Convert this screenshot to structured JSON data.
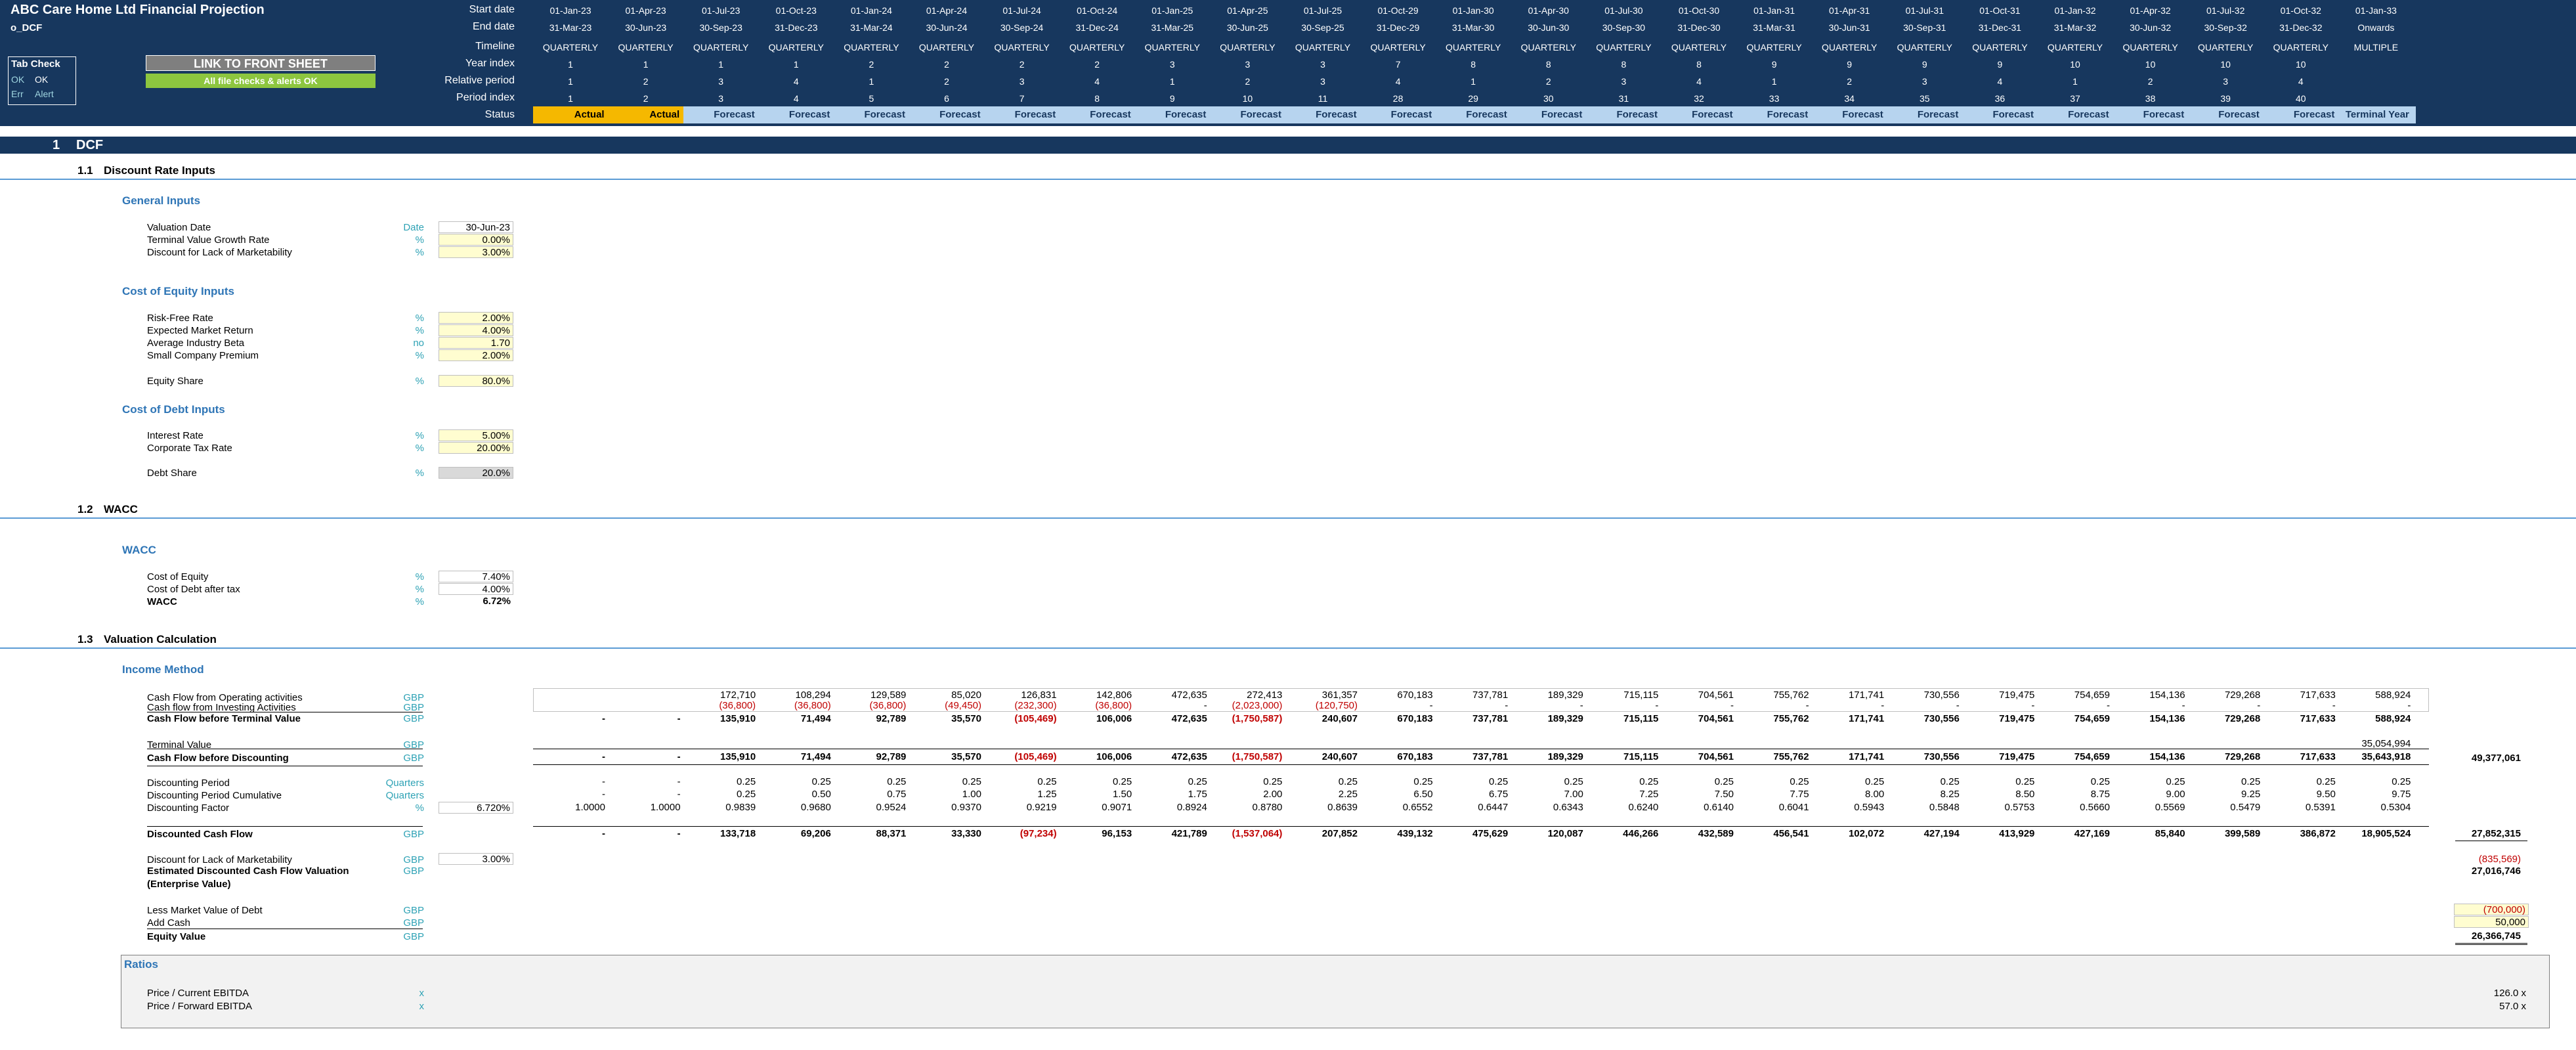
{
  "header": {
    "title": "ABC Care Home Ltd Financial Projection",
    "sheet": "o_DCF"
  },
  "tab_check": {
    "title": "Tab Check",
    "ok_a": "OK",
    "ok_b": "OK",
    "err": "Err",
    "alert": "Alert"
  },
  "buttons": {
    "front_sheet": "LINK TO FRONT SHEET",
    "checks": "All file checks & alerts OK"
  },
  "timeline_labels": [
    "Start date",
    "End date",
    "Timeline",
    "Year index",
    "Relative period",
    "Period index",
    "Status"
  ],
  "periods": [
    {
      "start": "01-Jan-23",
      "end": "31-Mar-23",
      "timeline": "QUARTERLY",
      "year": "1",
      "rel": "1",
      "idx": "1",
      "status": "Actual"
    },
    {
      "start": "01-Apr-23",
      "end": "30-Jun-23",
      "timeline": "QUARTERLY",
      "year": "1",
      "rel": "2",
      "idx": "2",
      "status": "Actual"
    },
    {
      "start": "01-Jul-23",
      "end": "30-Sep-23",
      "timeline": "QUARTERLY",
      "year": "1",
      "rel": "3",
      "idx": "3",
      "status": "Forecast"
    },
    {
      "start": "01-Oct-23",
      "end": "31-Dec-23",
      "timeline": "QUARTERLY",
      "year": "1",
      "rel": "4",
      "idx": "4",
      "status": "Forecast"
    },
    {
      "start": "01-Jan-24",
      "end": "31-Mar-24",
      "timeline": "QUARTERLY",
      "year": "2",
      "rel": "1",
      "idx": "5",
      "status": "Forecast"
    },
    {
      "start": "01-Apr-24",
      "end": "30-Jun-24",
      "timeline": "QUARTERLY",
      "year": "2",
      "rel": "2",
      "idx": "6",
      "status": "Forecast"
    },
    {
      "start": "01-Jul-24",
      "end": "30-Sep-24",
      "timeline": "QUARTERLY",
      "year": "2",
      "rel": "3",
      "idx": "7",
      "status": "Forecast"
    },
    {
      "start": "01-Oct-24",
      "end": "31-Dec-24",
      "timeline": "QUARTERLY",
      "year": "2",
      "rel": "4",
      "idx": "8",
      "status": "Forecast"
    },
    {
      "start": "01-Jan-25",
      "end": "31-Mar-25",
      "timeline": "QUARTERLY",
      "year": "3",
      "rel": "1",
      "idx": "9",
      "status": "Forecast"
    },
    {
      "start": "01-Apr-25",
      "end": "30-Jun-25",
      "timeline": "QUARTERLY",
      "year": "3",
      "rel": "2",
      "idx": "10",
      "status": "Forecast"
    },
    {
      "start": "01-Jul-25",
      "end": "30-Sep-25",
      "timeline": "QUARTERLY",
      "year": "3",
      "rel": "3",
      "idx": "11",
      "status": "Forecast"
    },
    {
      "start": "01-Oct-29",
      "end": "31-Dec-29",
      "timeline": "QUARTERLY",
      "year": "7",
      "rel": "4",
      "idx": "28",
      "status": "Forecast"
    },
    {
      "start": "01-Jan-30",
      "end": "31-Mar-30",
      "timeline": "QUARTERLY",
      "year": "8",
      "rel": "1",
      "idx": "29",
      "status": "Forecast"
    },
    {
      "start": "01-Apr-30",
      "end": "30-Jun-30",
      "timeline": "QUARTERLY",
      "year": "8",
      "rel": "2",
      "idx": "30",
      "status": "Forecast"
    },
    {
      "start": "01-Jul-30",
      "end": "30-Sep-30",
      "timeline": "QUARTERLY",
      "year": "8",
      "rel": "3",
      "idx": "31",
      "status": "Forecast"
    },
    {
      "start": "01-Oct-30",
      "end": "31-Dec-30",
      "timeline": "QUARTERLY",
      "year": "8",
      "rel": "4",
      "idx": "32",
      "status": "Forecast"
    },
    {
      "start": "01-Jan-31",
      "end": "31-Mar-31",
      "timeline": "QUARTERLY",
      "year": "9",
      "rel": "1",
      "idx": "33",
      "status": "Forecast"
    },
    {
      "start": "01-Apr-31",
      "end": "30-Jun-31",
      "timeline": "QUARTERLY",
      "year": "9",
      "rel": "2",
      "idx": "34",
      "status": "Forecast"
    },
    {
      "start": "01-Jul-31",
      "end": "30-Sep-31",
      "timeline": "QUARTERLY",
      "year": "9",
      "rel": "3",
      "idx": "35",
      "status": "Forecast"
    },
    {
      "start": "01-Oct-31",
      "end": "31-Dec-31",
      "timeline": "QUARTERLY",
      "year": "9",
      "rel": "4",
      "idx": "36",
      "status": "Forecast"
    },
    {
      "start": "01-Jan-32",
      "end": "31-Mar-32",
      "timeline": "QUARTERLY",
      "year": "10",
      "rel": "1",
      "idx": "37",
      "status": "Forecast"
    },
    {
      "start": "01-Apr-32",
      "end": "30-Jun-32",
      "timeline": "QUARTERLY",
      "year": "10",
      "rel": "2",
      "idx": "38",
      "status": "Forecast"
    },
    {
      "start": "01-Jul-32",
      "end": "30-Sep-32",
      "timeline": "QUARTERLY",
      "year": "10",
      "rel": "3",
      "idx": "39",
      "status": "Forecast"
    },
    {
      "start": "01-Oct-32",
      "end": "31-Dec-32",
      "timeline": "QUARTERLY",
      "year": "10",
      "rel": "4",
      "idx": "40",
      "status": "Forecast"
    },
    {
      "start": "01-Jan-33",
      "end": "Onwards",
      "timeline": "MULTIPLE",
      "year": "",
      "rel": "",
      "idx": "",
      "status": "Terminal Year"
    }
  ],
  "section": {
    "num": "1",
    "title": "DCF"
  },
  "sub1": {
    "num": "1.1",
    "title": "Discount Rate Inputs"
  },
  "sub2": {
    "num": "1.2",
    "title": "WACC"
  },
  "sub3": {
    "num": "1.3",
    "title": "Valuation Calculation"
  },
  "general": {
    "title": "General Inputs",
    "rows": [
      {
        "label": "Valuation Date",
        "unit": "Date",
        "value": "30-Jun-23"
      },
      {
        "label": "Terminal Value Growth Rate",
        "unit": "%",
        "value": "0.00%"
      },
      {
        "label": "Discount for Lack of Marketability",
        "unit": "%",
        "value": "3.00%"
      }
    ]
  },
  "equity": {
    "title": "Cost of Equity Inputs",
    "rows": [
      {
        "label": "Risk-Free Rate",
        "unit": "%",
        "value": "2.00%"
      },
      {
        "label": "Expected Market Return",
        "unit": "%",
        "value": "4.00%"
      },
      {
        "label": "Average Industry Beta",
        "unit": "no",
        "value": "1.70"
      },
      {
        "label": "Small Company Premium",
        "unit": "%",
        "value": "2.00%"
      },
      {
        "label": "Equity Share",
        "unit": "%",
        "value": "80.0%"
      }
    ]
  },
  "debt": {
    "title": "Cost of Debt Inputs",
    "rows": [
      {
        "label": "Interest Rate",
        "unit": "%",
        "value": "5.00%"
      },
      {
        "label": "Corporate Tax Rate",
        "unit": "%",
        "value": "20.00%"
      },
      {
        "label": "Debt Share",
        "unit": "%",
        "value": "20.0%"
      }
    ]
  },
  "wacc": {
    "title": "WACC",
    "rows": [
      {
        "label": "Cost of Equity",
        "unit": "%",
        "value": "7.40%"
      },
      {
        "label": "Cost of Debt after tax",
        "unit": "%",
        "value": "4.00%"
      },
      {
        "label": "WACC",
        "unit": "%",
        "value": "6.72%"
      }
    ]
  },
  "income": {
    "title": "Income Method",
    "labels": {
      "cfo": "Cash Flow from Operating activities",
      "cfi": "Cash flow from Investing Activities",
      "cfbtv": "Cash Flow before Terminal Value",
      "tv": "Terminal Value",
      "cfbd": "Cash Flow before Discounting",
      "dp": "Discounting Period",
      "dpc": "Discounting Period Cumulative",
      "df": "Discounting Factor",
      "dcf": "Discounted Cash Flow",
      "dlom": "Discount for Lack of Marketability",
      "edcf": "Estimated Discounted Cash Flow Valuation",
      "ev": "(Enterprise Value)",
      "lmvd": "Less Market Value of Debt",
      "cash": "Add Cash",
      "eqv": "Equity Value"
    },
    "units": {
      "gbp": "GBP",
      "quarters": "Quarters",
      "pct": "%"
    },
    "df_input": "6.720%",
    "dlom_input": "3.00%",
    "cfo": [
      "",
      "",
      "172,710",
      "108,294",
      "129,589",
      "85,020",
      "126,831",
      "142,806",
      "472,635",
      "272,413",
      "361,357",
      "670,183",
      "737,781",
      "189,329",
      "715,115",
      "704,561",
      "755,762",
      "171,741",
      "730,556",
      "719,475",
      "754,659",
      "154,136",
      "729,268",
      "717,633",
      "588,924"
    ],
    "cfi": [
      "",
      "",
      "(36,800)",
      "(36,800)",
      "(36,800)",
      "(49,450)",
      "(232,300)",
      "(36,800)",
      "-",
      "(2,023,000)",
      "(120,750)",
      "-",
      "-",
      "-",
      "-",
      "-",
      "-",
      "-",
      "-",
      "-",
      "-",
      "-",
      "-",
      "-",
      "-"
    ],
    "cfbtv": [
      "-",
      "-",
      "135,910",
      "71,494",
      "92,789",
      "35,570",
      "(105,469)",
      "106,006",
      "472,635",
      "(1,750,587)",
      "240,607",
      "670,183",
      "737,781",
      "189,329",
      "715,115",
      "704,561",
      "755,762",
      "171,741",
      "730,556",
      "719,475",
      "754,659",
      "154,136",
      "729,268",
      "717,633",
      "588,924"
    ],
    "tv": [
      "",
      "",
      "",
      "",
      "",
      "",
      "",
      "",
      "",
      "",
      "",
      "",
      "",
      "",
      "",
      "",
      "",
      "",
      "",
      "",
      "",
      "",
      "",
      "",
      "35,054,994"
    ],
    "cfbd": [
      "-",
      "-",
      "135,910",
      "71,494",
      "92,789",
      "35,570",
      "(105,469)",
      "106,006",
      "472,635",
      "(1,750,587)",
      "240,607",
      "670,183",
      "737,781",
      "189,329",
      "715,115",
      "704,561",
      "755,762",
      "171,741",
      "730,556",
      "719,475",
      "754,659",
      "154,136",
      "729,268",
      "717,633",
      "35,643,918"
    ],
    "dp": [
      "-",
      "-",
      "0.25",
      "0.25",
      "0.25",
      "0.25",
      "0.25",
      "0.25",
      "0.25",
      "0.25",
      "0.25",
      "0.25",
      "0.25",
      "0.25",
      "0.25",
      "0.25",
      "0.25",
      "0.25",
      "0.25",
      "0.25",
      "0.25",
      "0.25",
      "0.25",
      "0.25",
      "0.25"
    ],
    "dpc": [
      "-",
      "-",
      "0.25",
      "0.50",
      "0.75",
      "1.00",
      "1.25",
      "1.50",
      "1.75",
      "2.00",
      "2.25",
      "6.50",
      "6.75",
      "7.00",
      "7.25",
      "7.50",
      "7.75",
      "8.00",
      "8.25",
      "8.50",
      "8.75",
      "9.00",
      "9.25",
      "9.50",
      "9.75"
    ],
    "df": [
      "1.0000",
      "1.0000",
      "0.9839",
      "0.9680",
      "0.9524",
      "0.9370",
      "0.9219",
      "0.9071",
      "0.8924",
      "0.8780",
      "0.8639",
      "0.6552",
      "0.6447",
      "0.6343",
      "0.6240",
      "0.6140",
      "0.6041",
      "0.5943",
      "0.5848",
      "0.5753",
      "0.5660",
      "0.5569",
      "0.5479",
      "0.5391",
      "0.5304"
    ],
    "dcf": [
      "-",
      "-",
      "133,718",
      "69,206",
      "88,371",
      "33,330",
      "(97,234)",
      "96,153",
      "421,789",
      "(1,537,064)",
      "207,852",
      "439,132",
      "475,629",
      "120,087",
      "446,266",
      "432,589",
      "456,541",
      "102,072",
      "427,194",
      "413,929",
      "427,169",
      "85,840",
      "399,589",
      "386,872",
      "18,905,524"
    ],
    "totals": {
      "cfbd": "49,377,061",
      "dcf": "27,852,315",
      "dlom": "(835,569)",
      "edcf": "27,016,746",
      "lmvd": "(700,000)",
      "cash": "50,000",
      "eqv": "26,366,745"
    }
  },
  "ratios": {
    "title": "Ratios",
    "rows": [
      {
        "label": "Price / Current EBITDA",
        "unit": "x",
        "value": "126.0 x"
      },
      {
        "label": "Price / Forward EBITDA",
        "unit": "x",
        "value": "57.0 x"
      }
    ]
  }
}
